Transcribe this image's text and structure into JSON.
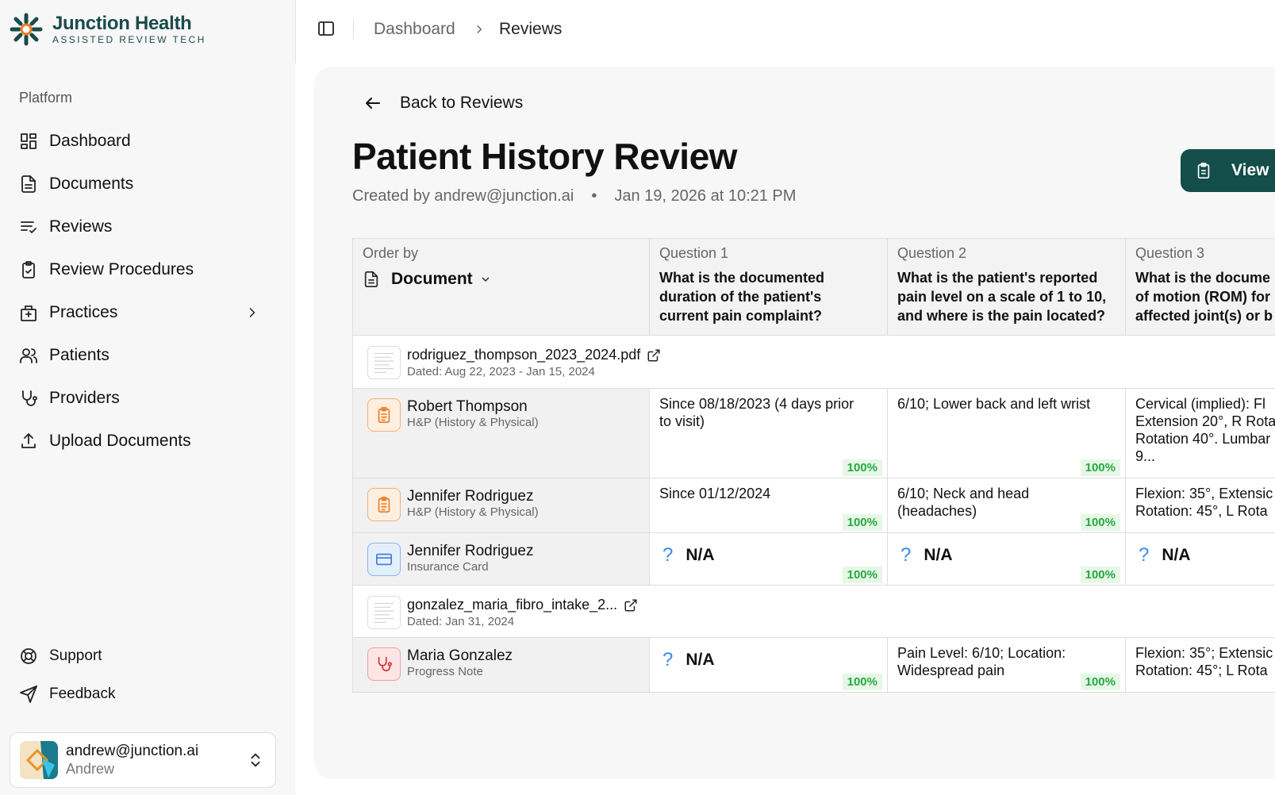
{
  "brand": {
    "title": "Junction Health",
    "subtitle": "ASSISTED REVIEW TECH"
  },
  "sidebar": {
    "section_label": "Platform",
    "items": [
      {
        "label": "Dashboard",
        "icon": "grid-icon"
      },
      {
        "label": "Documents",
        "icon": "document-icon"
      },
      {
        "label": "Reviews",
        "icon": "list-check-icon"
      },
      {
        "label": "Review Procedures",
        "icon": "clipboard-check-icon"
      },
      {
        "label": "Practices",
        "icon": "hospital-icon"
      },
      {
        "label": "Patients",
        "icon": "users-icon"
      },
      {
        "label": "Providers",
        "icon": "stethoscope-icon"
      },
      {
        "label": "Upload Documents",
        "icon": "upload-icon"
      }
    ],
    "bottom": [
      {
        "label": "Support",
        "icon": "lifebuoy-icon"
      },
      {
        "label": "Feedback",
        "icon": "send-icon"
      }
    ],
    "user": {
      "email": "andrew@junction.ai",
      "name": "Andrew"
    }
  },
  "header": {
    "breadcrumb": [
      "Dashboard",
      "Reviews"
    ]
  },
  "page": {
    "back_label": "Back to Reviews",
    "title": "Patient History Review",
    "created_by": "Created by andrew@junction.ai",
    "separator": "•",
    "created_at": "Jan 19, 2026 at 10:21 PM",
    "view_button": "View"
  },
  "table": {
    "order_label": "Order by",
    "order_value": "Document",
    "questions": [
      {
        "label": "Question 1",
        "text": "What is the documented\nduration of the patient's\ncurrent pain complaint?"
      },
      {
        "label": "Question 2",
        "text": "What is the patient's reported\npain level on a scale of 1 to 10,\nand where is the pain located?"
      },
      {
        "label": "Question 3",
        "text": "What is the docume\nof motion (ROM) for\naffected joint(s) or b"
      }
    ],
    "groups": [
      {
        "file": "rodriguez_thompson_2023_2024.pdf",
        "dated": "Dated: Aug 22, 2023 - Jan 15, 2024",
        "rows": [
          {
            "name": "Robert Thompson",
            "type": "H&P (History & Physical)",
            "icon": "clipboard-icon",
            "answers": [
              "Since 08/18/2023 (4 days prior\nto visit)",
              "6/10; Lower back and left wrist",
              "Cervical (implied): Fl\nExtension 20°, R Rota\nRotation 40°. Lumbar\n9..."
            ],
            "conf": [
              "100%",
              "100%",
              ""
            ]
          },
          {
            "name": "Jennifer Rodriguez",
            "type": "H&P (History & Physical)",
            "icon": "clipboard-icon",
            "answers": [
              "Since 01/12/2024",
              "6/10; Neck and head\n(headaches)",
              "Flexion: 35°, Extensic\nRotation: 45°, L Rota"
            ],
            "conf": [
              "100%",
              "100%",
              ""
            ]
          },
          {
            "name": "Jennifer Rodriguez",
            "type": "Insurance Card",
            "icon": "credit-card-icon",
            "answers": [
              "N/A",
              "N/A",
              "N/A"
            ],
            "conf": [
              "100%",
              "100%",
              ""
            ]
          }
        ]
      },
      {
        "file": "gonzalez_maria_fibro_intake_2...",
        "dated": "Dated: Jan 31, 2024",
        "rows": [
          {
            "name": "Maria Gonzalez",
            "type": "Progress Note",
            "icon": "stethoscope-icon",
            "answers": [
              "N/A",
              "Pain Level: 6/10; Location:\nWidespread pain",
              "Flexion: 35°; Extensic\nRotation: 45°; L Rota"
            ],
            "conf": [
              "100%",
              "100%",
              ""
            ]
          }
        ]
      }
    ],
    "na_symbol": "?"
  },
  "colors": {
    "brand": "#1a4b4c",
    "accent_button": "#134e4a",
    "confidence": "#27a844",
    "info": "#3a8bf0"
  }
}
